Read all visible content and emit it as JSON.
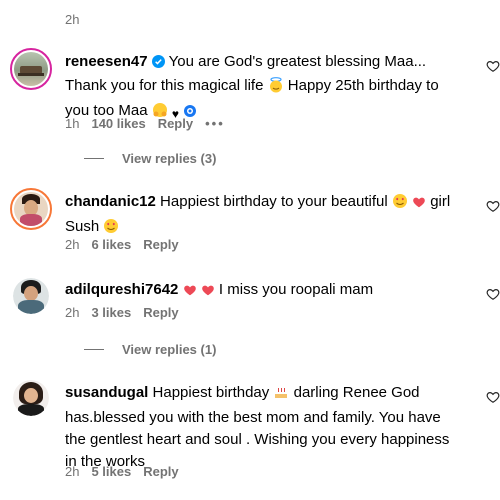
{
  "top": {
    "time": "2h"
  },
  "comments": [
    {
      "username": "reneesen47",
      "text": "You are God's greatest blessing Maa... Thank you for this magical life",
      "text2": "Happy 25th birthday to you too Maa",
      "time": "1h",
      "likes": "140 likes",
      "reply": "Reply",
      "more": "•••",
      "view_replies": "View replies (3)"
    },
    {
      "username": "chandanic12",
      "text": "Happiest birthday to your beautiful",
      "text2": "girl Sush",
      "time": "2h",
      "likes": "6 likes",
      "reply": "Reply"
    },
    {
      "username": "adilqureshi7642",
      "text": "I miss you roopali mam",
      "time": "2h",
      "likes": "3 likes",
      "reply": "Reply",
      "view_replies": "View replies (1)"
    },
    {
      "username": "susandugal",
      "text": "Happiest birthday",
      "text2": "darling Renee God has.blessed you with the best mom and family. You have the gentlest heart and soul . Wishing you every happiness in the works",
      "time": "2h",
      "likes": "5 likes",
      "reply": "Reply"
    }
  ],
  "colors": {
    "muted": "#737373",
    "verified": "#0095f6",
    "heart": "#ed4956"
  }
}
